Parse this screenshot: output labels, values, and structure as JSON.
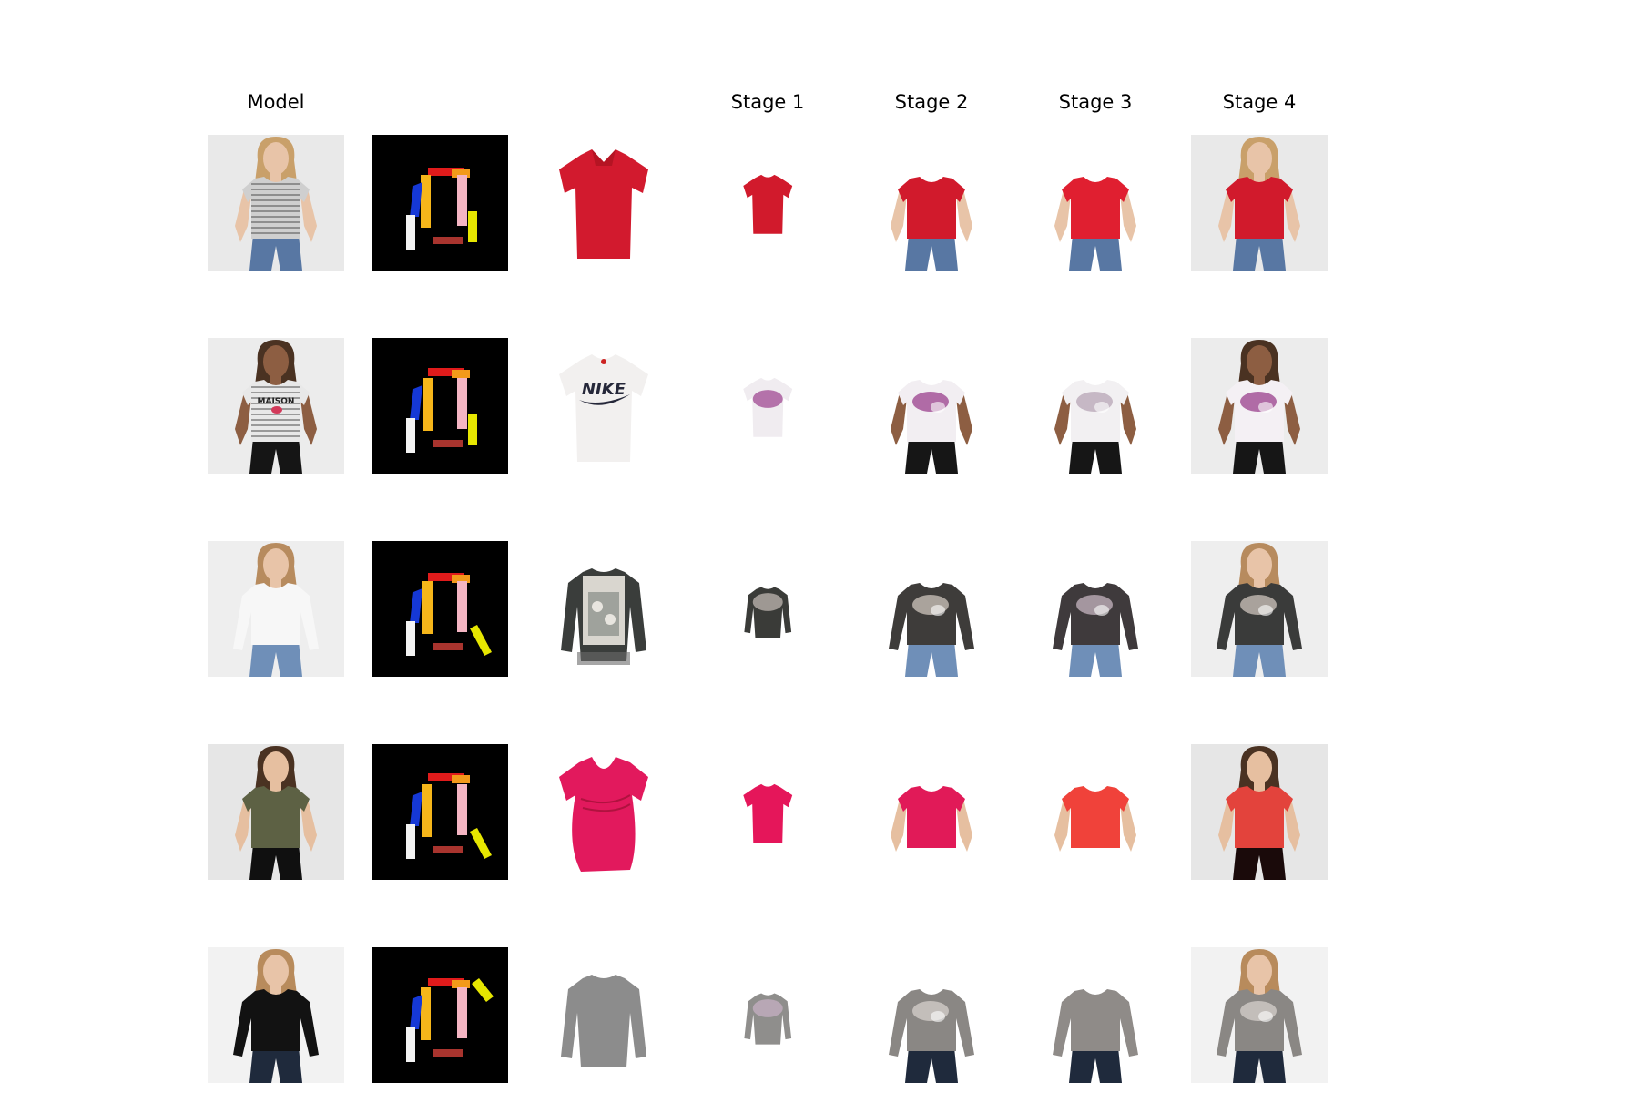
{
  "figure": {
    "column_headers": [
      "Model",
      "",
      "",
      "Stage 1",
      "Stage 2",
      "Stage 3",
      "Stage 4"
    ],
    "rows": [
      {
        "model": {
          "background": "#e9e9e9",
          "shirt": "#cfcfcf",
          "stripes": true,
          "shirt_type": "tee",
          "pants": "#5877a3",
          "hair": "#c9a06a",
          "skin": "#e8c4a8"
        },
        "garment": {
          "color": "#d21a2e",
          "type": "polo",
          "print": "none"
        },
        "stages": [
          {
            "style": "isolated",
            "color": "#d11a2c"
          },
          {
            "style": "worn",
            "color": "#d11a2c",
            "pants": "#5877a3"
          },
          {
            "style": "worn",
            "color": "#e01f30",
            "pants": "#5877a3"
          },
          {
            "style": "full",
            "color": "#d11a2c",
            "pants": "#5877a3",
            "hair": "#c9a06a"
          }
        ]
      },
      {
        "model": {
          "background": "#ececec",
          "shirt": "#e8e8e8",
          "stripes": true,
          "shirt_type": "tee",
          "pants": "#151515",
          "hair": "#4a3222",
          "skin": "#8d5e42",
          "shirt_text": "MAISON"
        },
        "garment": {
          "color": "#f2f0ef",
          "type": "tee",
          "print": "nike"
        },
        "stages": [
          {
            "style": "isolated",
            "color": "#f0ecf0",
            "smudge": "#9a3f8c"
          },
          {
            "style": "worn",
            "color": "#f2eef2",
            "smudge": "#9a3f8c",
            "pants": "#161616"
          },
          {
            "style": "worn",
            "color": "#f2f0f2",
            "smudge": "#b7a5b5",
            "pants": "#161616"
          },
          {
            "style": "full",
            "color": "#f4f0f4",
            "smudge": "#9a3f8c",
            "pants": "#161616",
            "hair": "#4a3222"
          }
        ]
      },
      {
        "model": {
          "background": "#eeeeee",
          "shirt": "#f7f7f7",
          "stripes": false,
          "shirt_type": "long",
          "pants": "#6f8fb8",
          "hair": "#b78b5e",
          "skin": "#e8c4a8"
        },
        "garment": {
          "color": "#3a3d3b",
          "type": "long",
          "print": "panel"
        },
        "stages": [
          {
            "style": "isolated",
            "color": "#3a3b38",
            "smudge": "#c9c1ba"
          },
          {
            "style": "worn",
            "color": "#3e3c3a",
            "smudge": "#cfc6bd",
            "pants": "#6f8fb8"
          },
          {
            "style": "worn",
            "color": "#3f3a3c",
            "smudge": "#c7b6c0",
            "pants": "#6f8fb8"
          },
          {
            "style": "full",
            "color": "#3a3b3a",
            "smudge": "#cfc6bd",
            "pants": "#6f8fb8",
            "hair": "#b78b5e"
          }
        ]
      },
      {
        "model": {
          "background": "#e6e6e6",
          "shirt": "#5d6144",
          "stripes": false,
          "shirt_type": "tee",
          "pants": "#101010",
          "hair": "#4a3222",
          "skin": "#e6bfa0"
        },
        "garment": {
          "color": "#e2195d",
          "type": "wrap",
          "print": "none"
        },
        "stages": [
          {
            "style": "isolated",
            "color": "#e5165a"
          },
          {
            "style": "worn",
            "color": "#e11a58",
            "pants": "#ffffff"
          },
          {
            "style": "worn",
            "color": "#f0423a",
            "pants": "#ffffff"
          },
          {
            "style": "full",
            "color": "#e3433c",
            "pants": "#1a0a0a",
            "hair": "#4a3222"
          }
        ]
      },
      {
        "model": {
          "background": "#f2f2f2",
          "shirt": "#121212",
          "stripes": false,
          "shirt_type": "long",
          "pants": "#1f2a3c",
          "hair": "#b88b5c",
          "skin": "#e8c4a8"
        },
        "garment": {
          "color": "#8c8c8c",
          "type": "long",
          "print": "none"
        },
        "stages": [
          {
            "style": "isolated",
            "color": "#8f8e8c",
            "smudge": "#c9b2c6"
          },
          {
            "style": "worn",
            "color": "#8a8784",
            "smudge": "#d6d0cc",
            "pants": "#1f2a3c"
          },
          {
            "style": "worn",
            "color": "#8f8b88",
            "pants": "#1f2a3c"
          },
          {
            "style": "full",
            "color": "#8a8784",
            "smudge": "#d6d0cc",
            "pants": "#1f2a3c",
            "hair": "#b88b5c"
          }
        ]
      }
    ]
  }
}
